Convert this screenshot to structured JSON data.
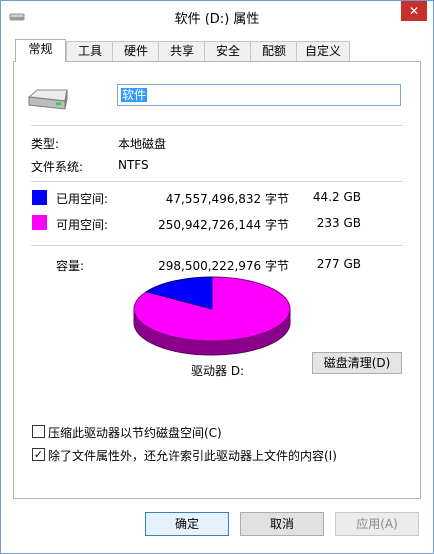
{
  "window": {
    "title": "软件 (D:) 属性",
    "close_glyph": "✕"
  },
  "tabs": [
    {
      "label": "常规",
      "active": true
    },
    {
      "label": "工具"
    },
    {
      "label": "硬件"
    },
    {
      "label": "共享"
    },
    {
      "label": "安全"
    },
    {
      "label": "配额"
    },
    {
      "label": "自定义"
    }
  ],
  "general": {
    "drive_name": "软件",
    "type_label": "类型:",
    "type_value": "本地磁盘",
    "fs_label": "文件系统:",
    "fs_value": "NTFS",
    "used": {
      "label": "已用空间:",
      "bytes": "47,557,496,832 字节",
      "size": "44.2 GB",
      "color": "#0000ff"
    },
    "free": {
      "label": "可用空间:",
      "bytes": "250,942,726,144 字节",
      "size": "233 GB",
      "color": "#ff00ff"
    },
    "capacity": {
      "label": "容量:",
      "bytes": "298,500,222,976 字节",
      "size": "277 GB"
    },
    "drive_label": "驱动器 D:",
    "cleanup_button": "磁盘清理(D)",
    "usage_fraction": 0.1593
  },
  "options": {
    "compress": {
      "label": "压缩此驱动器以节约磁盘空间(C)",
      "checked": false
    },
    "index": {
      "label": "除了文件属性外，还允许索引此驱动器上文件的内容(I)",
      "checked": true
    }
  },
  "buttons": {
    "ok": "确定",
    "cancel": "取消",
    "apply": "应用(A)"
  }
}
